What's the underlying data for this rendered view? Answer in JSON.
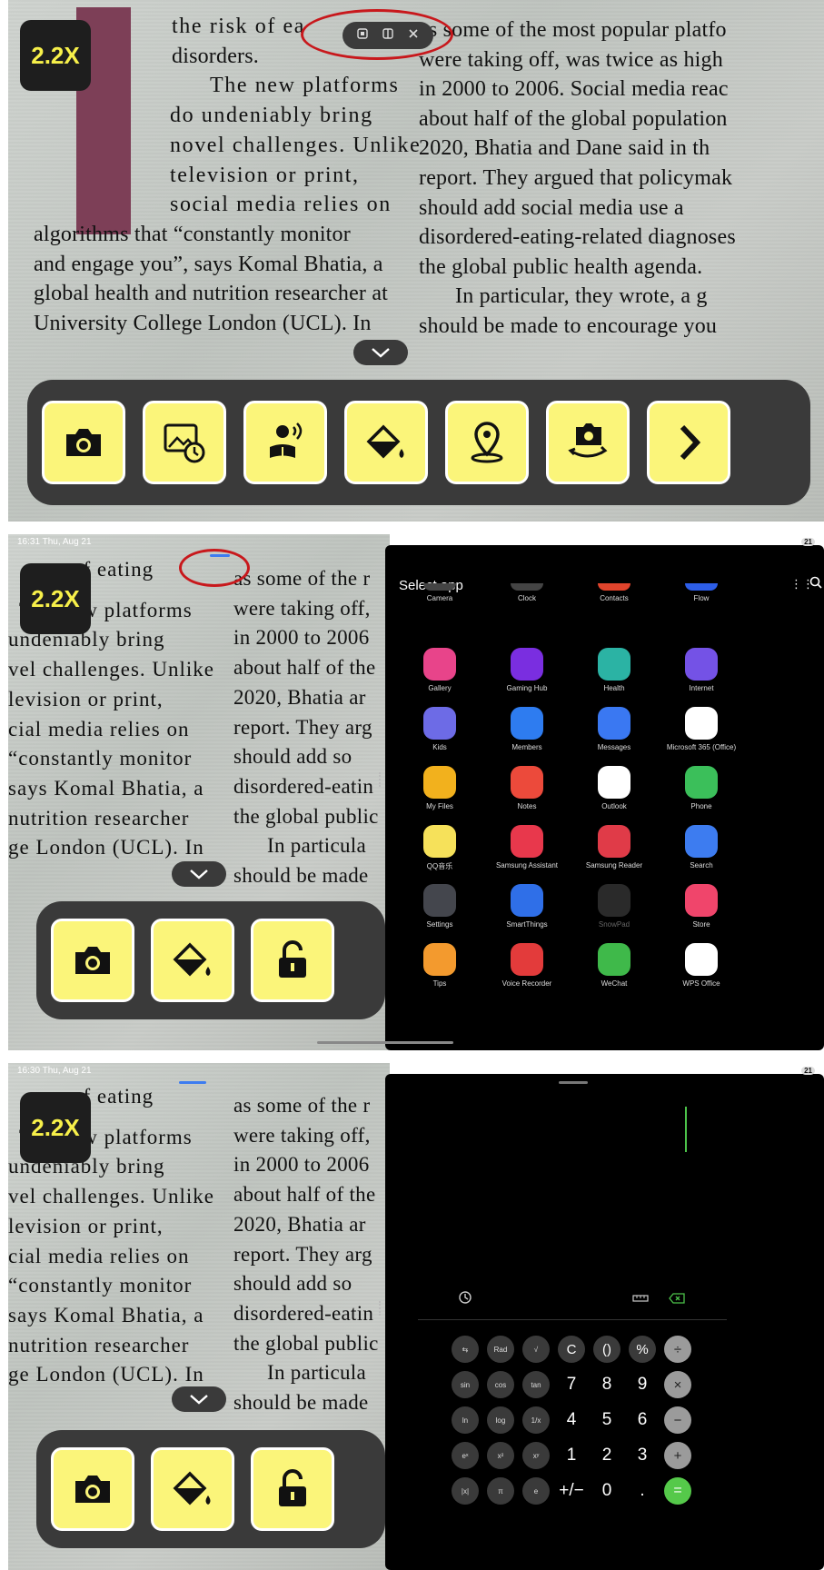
{
  "panel1": {
    "zoom": "2.2X",
    "left_lines": [
      "the risk of ea",
      "disorders.",
      "The new platforms",
      "do undeniably bring",
      "novel challenges. Unlike",
      "television or print,",
      "social media relies on",
      "algorithms that “constantly monitor",
      "and engage you”, says Komal Bhatia, a",
      "global health and nutrition researcher at",
      "University College London (UCL). In"
    ],
    "right_lines": [
      "as some of the most popular platfo",
      "were taking off, was twice as high",
      "in 2000 to 2006. Social media reac",
      "about half of the global population",
      "2020, Bhatia and Dane said in th",
      "report. They argued that policymak",
      "should add social media use a",
      "disordered-eating-related diagnoses",
      "the global public health agenda.",
      "In particular, they wrote, a g",
      "should be made to encourage you"
    ],
    "tools": [
      "camera-icon",
      "gallery-history-icon",
      "read-aloud-icon",
      "color-fill-icon",
      "location-pin-icon",
      "switch-camera-icon",
      "next-arrow-icon"
    ]
  },
  "panel2": {
    "status_time": "16:31  Thu, Aug 21",
    "battery": "21",
    "zoom": "2.2X",
    "left_lines": [
      "of eating",
      "The new platforms",
      "undeniably bring",
      "vel challenges. Unlike",
      "levision or print,",
      "cial media relies on",
      "“constantly monitor",
      " says Komal Bhatia, a",
      "nutrition researcher",
      "ge London (UCL). In"
    ],
    "mid_lines": [
      "as some of the r",
      "were taking off,",
      "in 2000 to 2006",
      "about half of the",
      "2020, Bhatia ar",
      "report. They arg",
      "should add so",
      "disordered-eatin",
      "the global public",
      "In particula",
      "should be made"
    ],
    "select_app_title": "Select app",
    "apps": [
      {
        "label": "Camera",
        "color": "#444"
      },
      {
        "label": "Clock",
        "color": "#444"
      },
      {
        "label": "Contacts",
        "color": "#e0442c"
      },
      {
        "label": "Flow",
        "color": "#2d5ee8"
      },
      {
        "label": "Gallery",
        "color": "#e8448a"
      },
      {
        "label": "Gaming Hub",
        "color": "#7a2ee0"
      },
      {
        "label": "Health",
        "color": "#2bb3a4"
      },
      {
        "label": "Internet",
        "color": "#7452e6"
      },
      {
        "label": "Kids",
        "color": "#6d6be6"
      },
      {
        "label": "Members",
        "color": "#2e7cf0"
      },
      {
        "label": "Messages",
        "color": "#3a78f2"
      },
      {
        "label": "Microsoft 365 (Office)",
        "color": "#ffffff"
      },
      {
        "label": "My Files",
        "color": "#f2b11d"
      },
      {
        "label": "Notes",
        "color": "#ec4a3b"
      },
      {
        "label": "Outlook",
        "color": "#ffffff"
      },
      {
        "label": "Phone",
        "color": "#3bbf5a"
      },
      {
        "label": "QQ音乐",
        "color": "#f6e15a"
      },
      {
        "label": "Samsung Assistant",
        "color": "#e8384c"
      },
      {
        "label": "Samsung Reader",
        "color": "#e03b48"
      },
      {
        "label": "Search",
        "color": "#3d7cf0"
      },
      {
        "label": "Settings",
        "color": "#44464d"
      },
      {
        "label": "SmartThings",
        "color": "#2f6fe8"
      },
      {
        "label": "SnowPad",
        "color": "#2a2a2a"
      },
      {
        "label": "Store",
        "color": "#f0456b"
      },
      {
        "label": "Tips",
        "color": "#f39a2e"
      },
      {
        "label": "Voice Recorder",
        "color": "#e33b3b"
      },
      {
        "label": "WeChat",
        "color": "#3fb94a"
      },
      {
        "label": "WPS Office",
        "color": "#ffffff"
      }
    ]
  },
  "panel3": {
    "status_time": "16:30  Thu, Aug 21",
    "battery": "21",
    "zoom": "2.2X",
    "calc_rows": [
      [
        "⇆",
        "Rad",
        "√",
        "C",
        "()",
        "%",
        "÷"
      ],
      [
        "sin",
        "cos",
        "tan",
        "7",
        "8",
        "9",
        "×"
      ],
      [
        "ln",
        "log",
        "1/x",
        "4",
        "5",
        "6",
        "−"
      ],
      [
        "eˣ",
        "x²",
        "xʸ",
        "1",
        "2",
        "3",
        "+"
      ],
      [
        "|x|",
        "π",
        "e",
        "+/−",
        "0",
        ".",
        "="
      ]
    ]
  }
}
